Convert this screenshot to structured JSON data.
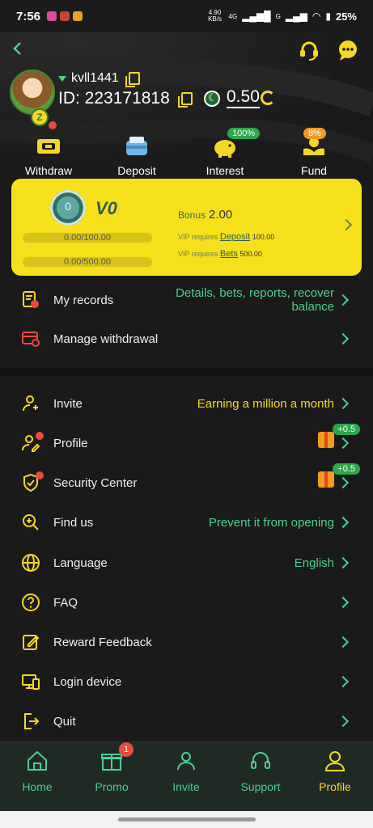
{
  "status_bar": {
    "time": "7:56",
    "net_speed": "4.90 KB/s",
    "network": "4G",
    "network2": "G",
    "battery": "25%"
  },
  "user": {
    "username": "kvll1441",
    "id_label": "ID: 223171818",
    "balance": "0.50"
  },
  "quick_actions": [
    {
      "label": "Withdraw"
    },
    {
      "label": "Deposit"
    },
    {
      "label": "Interest",
      "badge": "100%"
    },
    {
      "label": "Fund",
      "badge": "8%"
    }
  ],
  "vip": {
    "level": "V0",
    "medal_number": "0",
    "progress1": "0.00/100.00",
    "progress2": "0.00/500.00",
    "bonus_label": "Bonus",
    "bonus_value": "2.00",
    "req_deposit_prefix": "VIP requires",
    "req_deposit_link": "Deposit",
    "req_deposit_value": "100.00",
    "req_bets_prefix": "VIP requires",
    "req_bets_link": "Bets",
    "req_bets_value": "500.00"
  },
  "menu_top": [
    {
      "label": "My records",
      "value": "Details, bets, reports, recover balance"
    },
    {
      "label": "Manage withdrawal",
      "value": ""
    }
  ],
  "menu_main": [
    {
      "label": "Invite",
      "value": "Earning a million a month"
    },
    {
      "label": "Profile",
      "value": "",
      "gift": "+0.5"
    },
    {
      "label": "Security Center",
      "value": "",
      "gift": "+0.5"
    },
    {
      "label": "Find us",
      "value": "Prevent it from opening"
    },
    {
      "label": "Language",
      "value": "English"
    },
    {
      "label": "FAQ",
      "value": ""
    },
    {
      "label": "Reward Feedback",
      "value": ""
    },
    {
      "label": "Login device",
      "value": ""
    },
    {
      "label": "Quit",
      "value": ""
    }
  ],
  "bottom_nav": [
    {
      "label": "Home"
    },
    {
      "label": "Promo",
      "badge": "1"
    },
    {
      "label": "Invite"
    },
    {
      "label": "Support"
    },
    {
      "label": "Profile",
      "active": true
    }
  ],
  "colors": {
    "accent": "#f6d628",
    "green": "#4ccf8f",
    "vip_card": "#f6e01c"
  }
}
